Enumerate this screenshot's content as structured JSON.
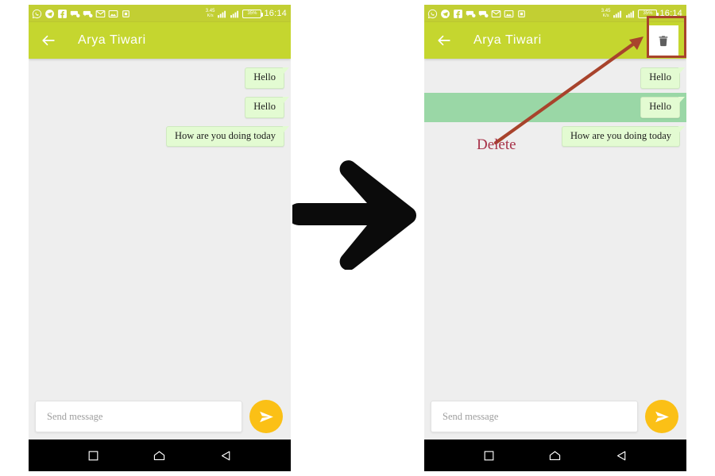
{
  "statusbar": {
    "app_icons": [
      "whatsapp-icon",
      "telegram-icon",
      "facebook-icon",
      "chat-icon",
      "chat-icon",
      "mail-icon",
      "gallery-icon",
      "app-icon"
    ],
    "data_speed": "3.45",
    "data_speed_unit": "K/s",
    "battery_percent": "35%",
    "time": "16:14",
    "background": "#c2cf33"
  },
  "appbar": {
    "title": "Arya Tiwari",
    "back_label": "back-arrow",
    "delete_label": "Delete",
    "background": "#c5d62f"
  },
  "chat": {
    "background": "#eeeeee",
    "bubble_color": "#e3fbd2",
    "selection_color": "#9ad7a6",
    "messages": [
      {
        "text": "Hello",
        "selected": false
      },
      {
        "text": "Hello",
        "selected": false
      },
      {
        "text": "How are you doing today",
        "selected": false
      }
    ],
    "messages_selected": [
      {
        "text": "Hello",
        "selected": false
      },
      {
        "text": "Hello",
        "selected": true
      },
      {
        "text": "How are you doing today",
        "selected": false
      }
    ]
  },
  "composer": {
    "placeholder": "Send message",
    "value": "",
    "send_button_color": "#fbc016",
    "send_icon": "send-icon"
  },
  "navbar": {
    "items": [
      "recents-square-icon",
      "home-icon",
      "back-triangle-icon"
    ],
    "background": "#000000"
  },
  "annotations": {
    "delete_text": "Delete",
    "delete_color": "#a8334a",
    "highlight_color": "#a8432c",
    "step_arrow": "right-arrow-icon"
  }
}
